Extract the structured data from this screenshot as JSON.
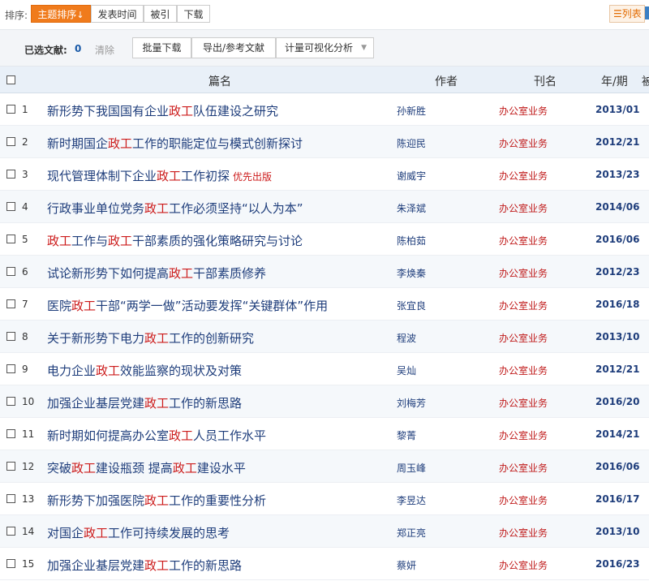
{
  "sort": {
    "label": "排序:",
    "options": [
      "主题排序",
      "发表时间",
      "被引",
      "下载"
    ],
    "active_arrow": "↓",
    "view_label": "列表",
    "view_icon": "☰"
  },
  "selection": {
    "label": "已选文献:",
    "count": "0",
    "clear": "清除",
    "buttons": [
      "批量下载",
      "导出/参考文献",
      "计量可视化分析"
    ],
    "dropdown_caret": "▼"
  },
  "table": {
    "columns": [
      "篇名",
      "作者",
      "刊名",
      "年/期",
      "被"
    ],
    "highlight": "政工",
    "rows": [
      {
        "num": "1",
        "title": "新形势下我国国有企业政工队伍建设之研究",
        "tag": "",
        "author": "孙新胜",
        "journal": "办公室业务",
        "issue": "2013/01"
      },
      {
        "num": "2",
        "title": "新时期国企政工工作的职能定位与模式创新探讨",
        "tag": "",
        "author": "陈迎民",
        "journal": "办公室业务",
        "issue": "2012/21"
      },
      {
        "num": "3",
        "title": "现代管理体制下企业政工工作初探",
        "tag": "优先出版",
        "author": "谢威宇",
        "journal": "办公室业务",
        "issue": "2013/23"
      },
      {
        "num": "4",
        "title": "行政事业单位党务政工工作必须坚持“以人为本”",
        "tag": "",
        "author": "朱泽斌",
        "journal": "办公室业务",
        "issue": "2014/06"
      },
      {
        "num": "5",
        "title": "政工工作与政工干部素质的强化策略研究与讨论",
        "tag": "",
        "author": "陈柏茹",
        "journal": "办公室业务",
        "issue": "2016/06"
      },
      {
        "num": "6",
        "title": "试论新形势下如何提高政工干部素质修养",
        "tag": "",
        "author": "李焕秦",
        "journal": "办公室业务",
        "issue": "2012/23"
      },
      {
        "num": "7",
        "title": "医院政工干部“两学一做”活动要发挥“关键群体”作用",
        "tag": "",
        "author": "张宜良",
        "journal": "办公室业务",
        "issue": "2016/18"
      },
      {
        "num": "8",
        "title": "关于新形势下电力政工工作的创新研究",
        "tag": "",
        "author": "程波",
        "journal": "办公室业务",
        "issue": "2013/10"
      },
      {
        "num": "9",
        "title": "电力企业政工效能监察的现状及对策",
        "tag": "",
        "author": "吴灿",
        "journal": "办公室业务",
        "issue": "2012/21"
      },
      {
        "num": "10",
        "title": "加强企业基层党建政工工作的新思路",
        "tag": "",
        "author": "刘梅芳",
        "journal": "办公室业务",
        "issue": "2016/20"
      },
      {
        "num": "11",
        "title": "新时期如何提高办公室政工人员工作水平",
        "tag": "",
        "author": "黎菁",
        "journal": "办公室业务",
        "issue": "2014/21"
      },
      {
        "num": "12",
        "title": "突破政工建设瓶颈 提高政工建设水平",
        "tag": "",
        "author": "周玉峰",
        "journal": "办公室业务",
        "issue": "2016/06"
      },
      {
        "num": "13",
        "title": "新形势下加强医院政工工作的重要性分析",
        "tag": "",
        "author": "李昱达",
        "journal": "办公室业务",
        "issue": "2016/17"
      },
      {
        "num": "14",
        "title": "对国企政工工作可持续发展的思考",
        "tag": "",
        "author": "郑正亮",
        "journal": "办公室业务",
        "issue": "2013/10"
      },
      {
        "num": "15",
        "title": "加强企业基层党建政工工作的新思路",
        "tag": "",
        "author": "蔡妍",
        "journal": "办公室业务",
        "issue": "2016/23"
      }
    ]
  }
}
